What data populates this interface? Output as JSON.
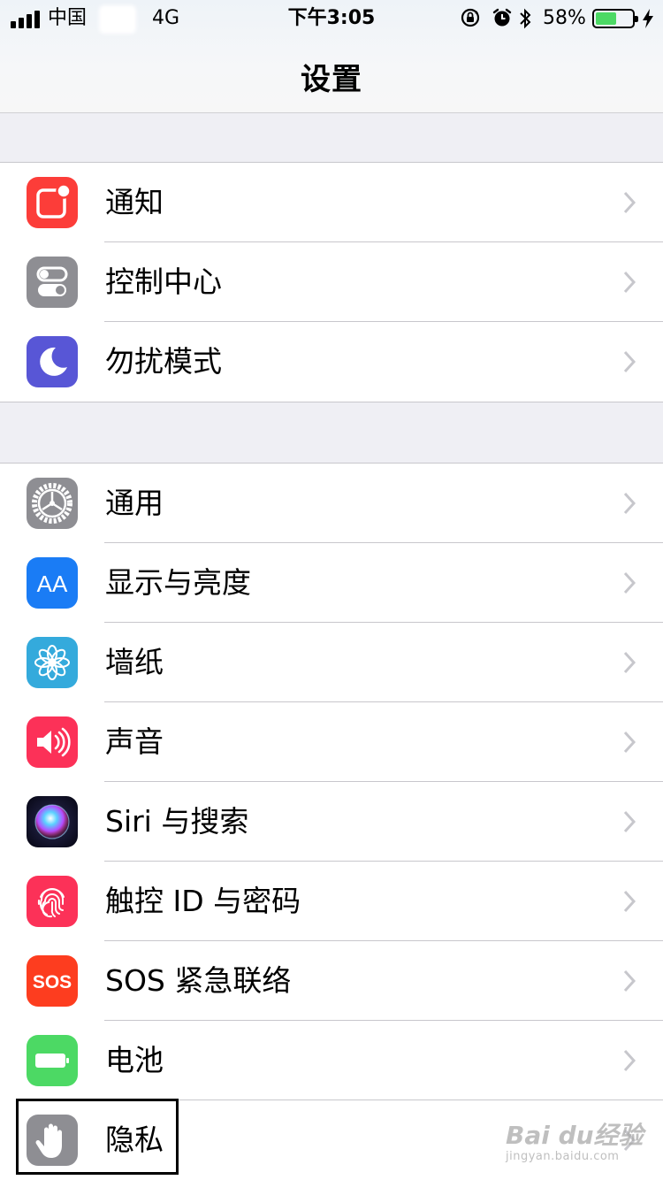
{
  "status_bar": {
    "carrier": "中国",
    "network": "4G",
    "time": "下午3:05",
    "battery_percent_label": "58%",
    "battery_level": 0.58,
    "icons": [
      "signal-icon",
      "orientation-lock-icon",
      "alarm-icon",
      "bluetooth-icon",
      "battery-icon",
      "charging-icon"
    ]
  },
  "nav": {
    "title": "设置"
  },
  "groups": [
    {
      "items": [
        {
          "label": "通知",
          "icon": "notifications-icon",
          "color": "#fc3d39"
        },
        {
          "label": "控制中心",
          "icon": "control-center-icon",
          "color": "#8e8e93"
        },
        {
          "label": "勿扰模式",
          "icon": "moon-icon",
          "color": "#5856d6"
        }
      ]
    },
    {
      "items": [
        {
          "label": "通用",
          "icon": "gear-icon",
          "color": "#8e8e93"
        },
        {
          "label": "显示与亮度",
          "icon": "display-aa-icon",
          "color": "#1a7cf5"
        },
        {
          "label": "墙纸",
          "icon": "wallpaper-flower-icon",
          "color": "#34aadc"
        },
        {
          "label": "声音",
          "icon": "speaker-icon",
          "color": "#fc3158"
        },
        {
          "label": "Siri 与搜索",
          "icon": "siri-icon",
          "color": "#1c1c3a"
        },
        {
          "label": "触控 ID 与密码",
          "icon": "fingerprint-icon",
          "color": "#fc3158"
        },
        {
          "label": "SOS 紧急联络",
          "icon": "sos-icon",
          "color": "#fd3d1f"
        },
        {
          "label": "电池",
          "icon": "battery-app-icon",
          "color": "#4cd964"
        },
        {
          "label": "隐私",
          "icon": "hand-icon",
          "color": "#8e8e93"
        }
      ]
    }
  ],
  "sos_icon_text": "SOS",
  "display_icon_text": "AA",
  "watermark": {
    "brand": "Bai du经验",
    "url": "jingyan.baidu.com"
  }
}
